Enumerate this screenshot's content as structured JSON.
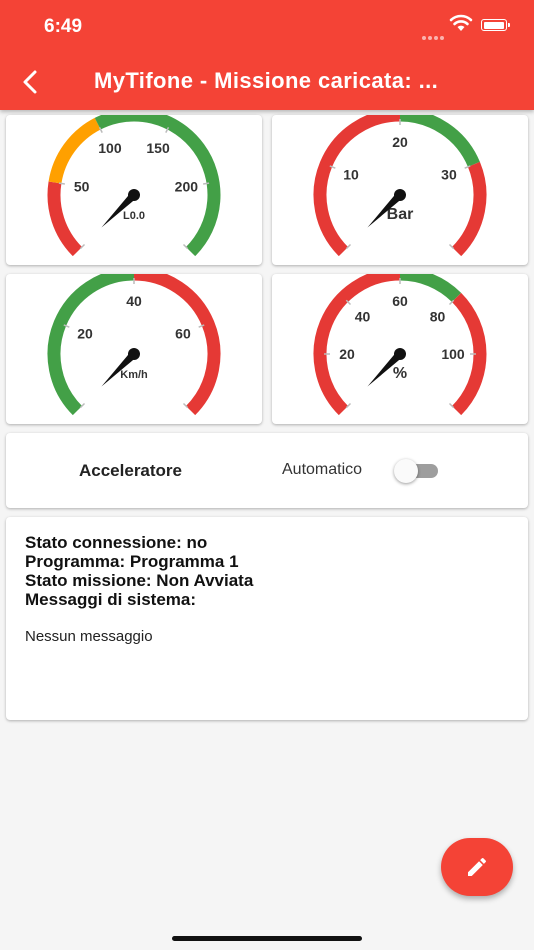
{
  "status_bar": {
    "time": "6:49"
  },
  "app_bar": {
    "title": "MyTifone - Missione caricata: ..."
  },
  "icons": {
    "back": "arrow-back-icon",
    "wifi": "wifi-icon",
    "battery": "battery-icon",
    "edit": "pencil-icon"
  },
  "colors": {
    "primary": "#f44336",
    "gauge_red": "#e53935",
    "gauge_orange": "#ffa000",
    "gauge_green": "#43a047"
  },
  "gauges": [
    {
      "name": "gauge-1",
      "label": "L0.0",
      "min": 0,
      "max": 250,
      "value": 0,
      "tick_labels": [
        {
          "value": 50,
          "text": "50"
        },
        {
          "value": 100,
          "text": "100"
        },
        {
          "value": 150,
          "text": "150"
        },
        {
          "value": 200,
          "text": "200"
        }
      ],
      "ranges": [
        {
          "from": 0,
          "to": 50,
          "color": "#e53935"
        },
        {
          "from": 50,
          "to": 100,
          "color": "#ffa000"
        },
        {
          "from": 100,
          "to": 250,
          "color": "#43a047"
        }
      ]
    },
    {
      "name": "gauge-2",
      "label": "Bar",
      "min": 0,
      "max": 40,
      "value": 0,
      "tick_labels": [
        {
          "value": 10,
          "text": "10"
        },
        {
          "value": 20,
          "text": "20"
        },
        {
          "value": 30,
          "text": "30"
        }
      ],
      "ranges": [
        {
          "from": 0,
          "to": 20,
          "color": "#e53935"
        },
        {
          "from": 20,
          "to": 30,
          "color": "#43a047"
        },
        {
          "from": 30,
          "to": 40,
          "color": "#e53935"
        }
      ]
    },
    {
      "name": "gauge-3",
      "label": "Km/h",
      "min": 0,
      "max": 80,
      "value": 0,
      "tick_labels": [
        {
          "value": 20,
          "text": "20"
        },
        {
          "value": 40,
          "text": "40"
        },
        {
          "value": 60,
          "text": "60"
        }
      ],
      "ranges": [
        {
          "from": 0,
          "to": 40,
          "color": "#43a047"
        },
        {
          "from": 40,
          "to": 80,
          "color": "#e53935"
        }
      ]
    },
    {
      "name": "gauge-4",
      "label": "%",
      "min": 0,
      "max": 120,
      "value": 0,
      "tick_labels": [
        {
          "value": 20,
          "text": "20"
        },
        {
          "value": 40,
          "text": "40"
        },
        {
          "value": 60,
          "text": "60"
        },
        {
          "value": 80,
          "text": "80"
        },
        {
          "value": 100,
          "text": "100"
        }
      ],
      "ranges": [
        {
          "from": 0,
          "to": 60,
          "color": "#e53935"
        },
        {
          "from": 60,
          "to": 80,
          "color": "#43a047"
        },
        {
          "from": 80,
          "to": 120,
          "color": "#e53935"
        }
      ]
    }
  ],
  "controls": {
    "accelerator_label": "Acceleratore",
    "automatic_label": "Automatico",
    "automatic_on": false
  },
  "status": {
    "connection": "Stato connessione: no",
    "program": "Programma: Programma 1",
    "mission": "Stato missione: Non Avviata",
    "messages_title": "Messaggi di sistema:",
    "message": "Nessun messaggio"
  }
}
